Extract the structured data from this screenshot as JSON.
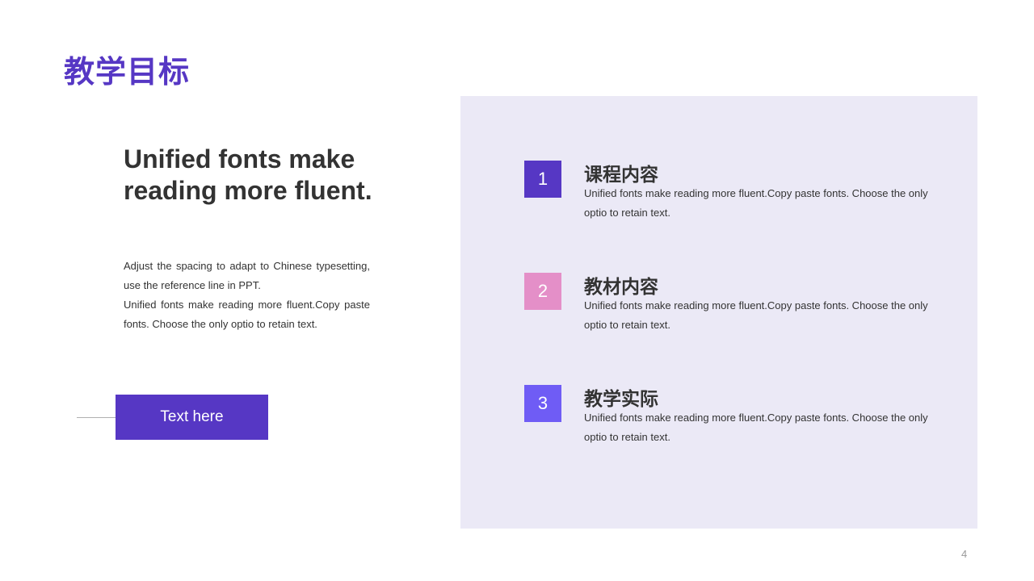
{
  "colors": {
    "accent": "#5637c4",
    "panel_bg": "#ebe9f6",
    "item_1": "#5637c4",
    "item_2": "#e48fc8",
    "item_3": "#6f5cf5"
  },
  "page_title": "教学目标",
  "left": {
    "headline": "Unified fonts make reading more fluent.",
    "paragraph_1": "Adjust the spacing to adapt to Chinese typesetting, use the reference line in PPT.",
    "paragraph_2": "Unified fonts make reading more fluent.Copy paste fonts. Choose the only optio to retain text.",
    "button_label": "Text here"
  },
  "items": [
    {
      "number": "1",
      "title": "课程内容",
      "desc": "Unified fonts make reading more fluent.Copy paste fonts. Choose the only optio to retain text."
    },
    {
      "number": "2",
      "title": "教材内容",
      "desc": "Unified fonts make reading more fluent.Copy paste fonts. Choose the only optio to retain text."
    },
    {
      "number": "3",
      "title": "教学实际",
      "desc": "Unified fonts make reading more fluent.Copy paste fonts. Choose the only optio to retain text."
    }
  ],
  "page_number": "4"
}
